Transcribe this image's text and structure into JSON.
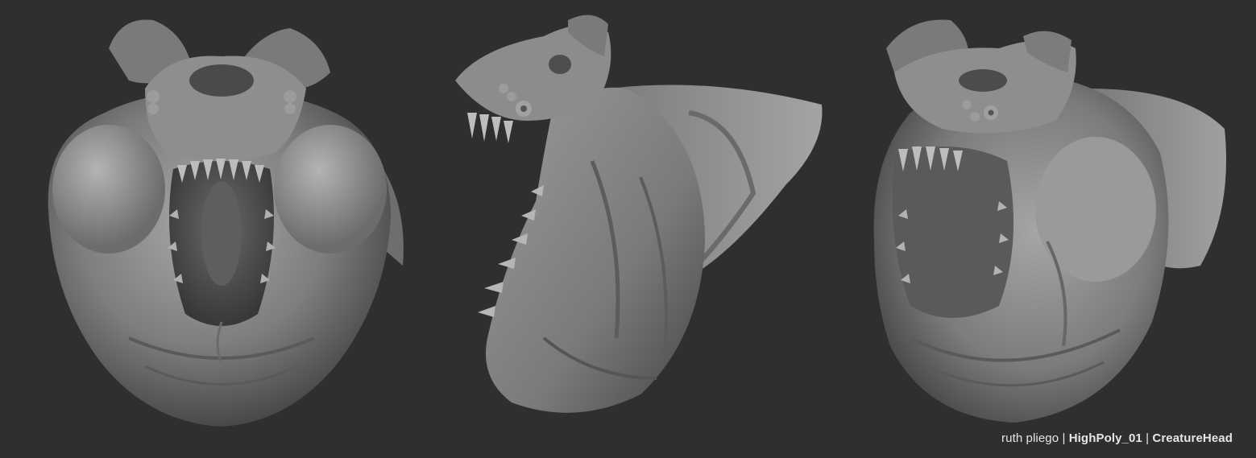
{
  "credit": {
    "artist": "ruth pliego",
    "separator_1": " | ",
    "asset_stage": "HighPoly_01",
    "separator_2": " | ",
    "asset_name": "CreatureHead"
  },
  "scene": {
    "background_color": "#2f2f2f",
    "clay_color": "#8a8a8a",
    "views": [
      "front",
      "three-quarter-side",
      "three-quarter"
    ]
  }
}
